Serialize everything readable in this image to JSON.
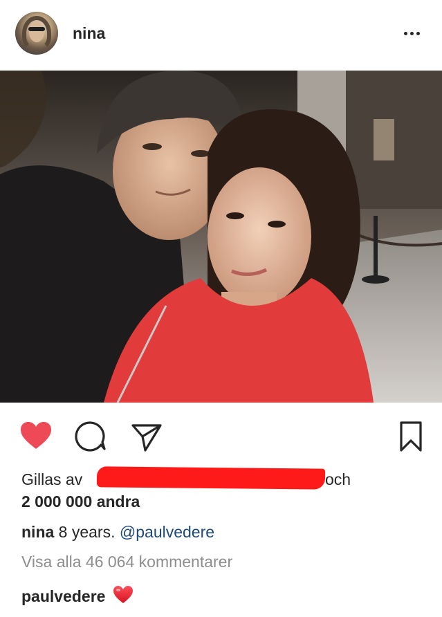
{
  "header": {
    "username": "nina",
    "avatar_icon": "profile-avatar",
    "more_icon": "more-options-icon"
  },
  "post": {
    "photo_description": "",
    "liked": true
  },
  "actions": {
    "like_icon": "heart-filled-icon",
    "comment_icon": "comment-bubble-icon",
    "share_icon": "paper-plane-icon",
    "save_icon": "bookmark-icon",
    "like_color": "#ed4956"
  },
  "likes": {
    "prefix": "Gillas av",
    "suffix": "och",
    "count_text": "2 000 000 andra",
    "redaction_color": "#ff1a1a"
  },
  "caption": {
    "user": "nina",
    "time": "8 years.",
    "mention": "@paulvedere"
  },
  "comments": {
    "view_all": "Visa alla 46 064 kommentarer",
    "first_user": "paulvedere",
    "first_emoji": "red-heart-emoji"
  }
}
